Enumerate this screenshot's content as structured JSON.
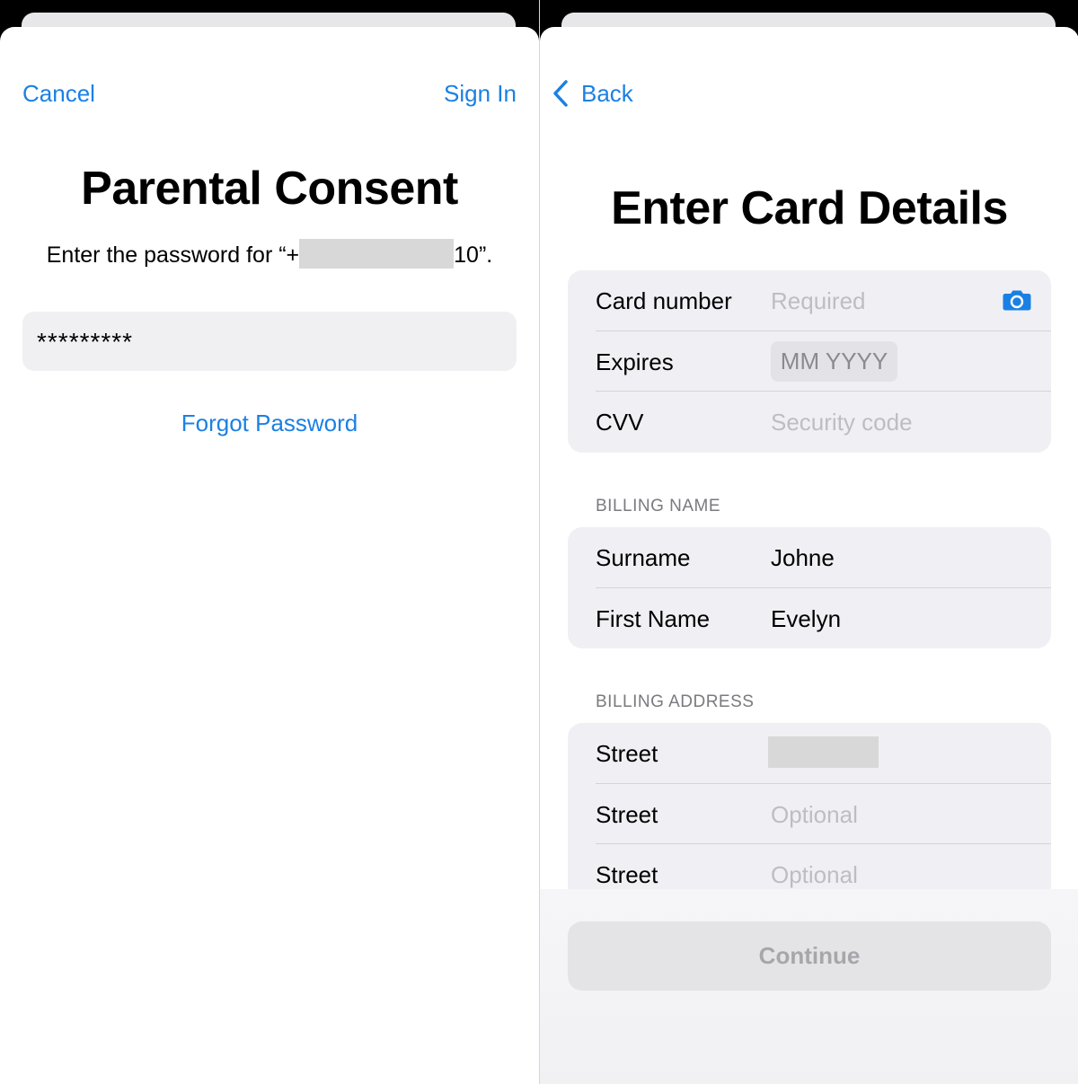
{
  "left": {
    "nav": {
      "cancel": "Cancel",
      "sign_in": "Sign In"
    },
    "title": "Parental Consent",
    "prompt_prefix": "Enter the password for “+",
    "prompt_suffix": "10”.",
    "password_value": "*********",
    "forgot_password": "Forgot Password"
  },
  "right": {
    "nav": {
      "back": "Back"
    },
    "title": "Enter Card Details",
    "card": {
      "card_number": {
        "label": "Card number",
        "placeholder": "Required"
      },
      "expires": {
        "label": "Expires",
        "placeholder": "MM YYYY"
      },
      "cvv": {
        "label": "CVV",
        "placeholder": "Security code"
      }
    },
    "billing_name": {
      "header": "BILLING NAME",
      "surname": {
        "label": "Surname",
        "value": "Johne"
      },
      "first_name": {
        "label": "First Name",
        "value": "Evelyn"
      }
    },
    "billing_address": {
      "header": "BILLING ADDRESS",
      "street1": {
        "label": "Street"
      },
      "street2": {
        "label": "Street",
        "placeholder": "Optional"
      },
      "street3": {
        "label": "Street",
        "placeholder": "Optional"
      }
    },
    "continue": "Continue"
  },
  "colors": {
    "accent": "#1b80e3",
    "placeholder": "#bdbdc2",
    "group_bg": "#f0f0f4"
  },
  "icons": [
    "chevron-left-icon",
    "camera-icon"
  ]
}
